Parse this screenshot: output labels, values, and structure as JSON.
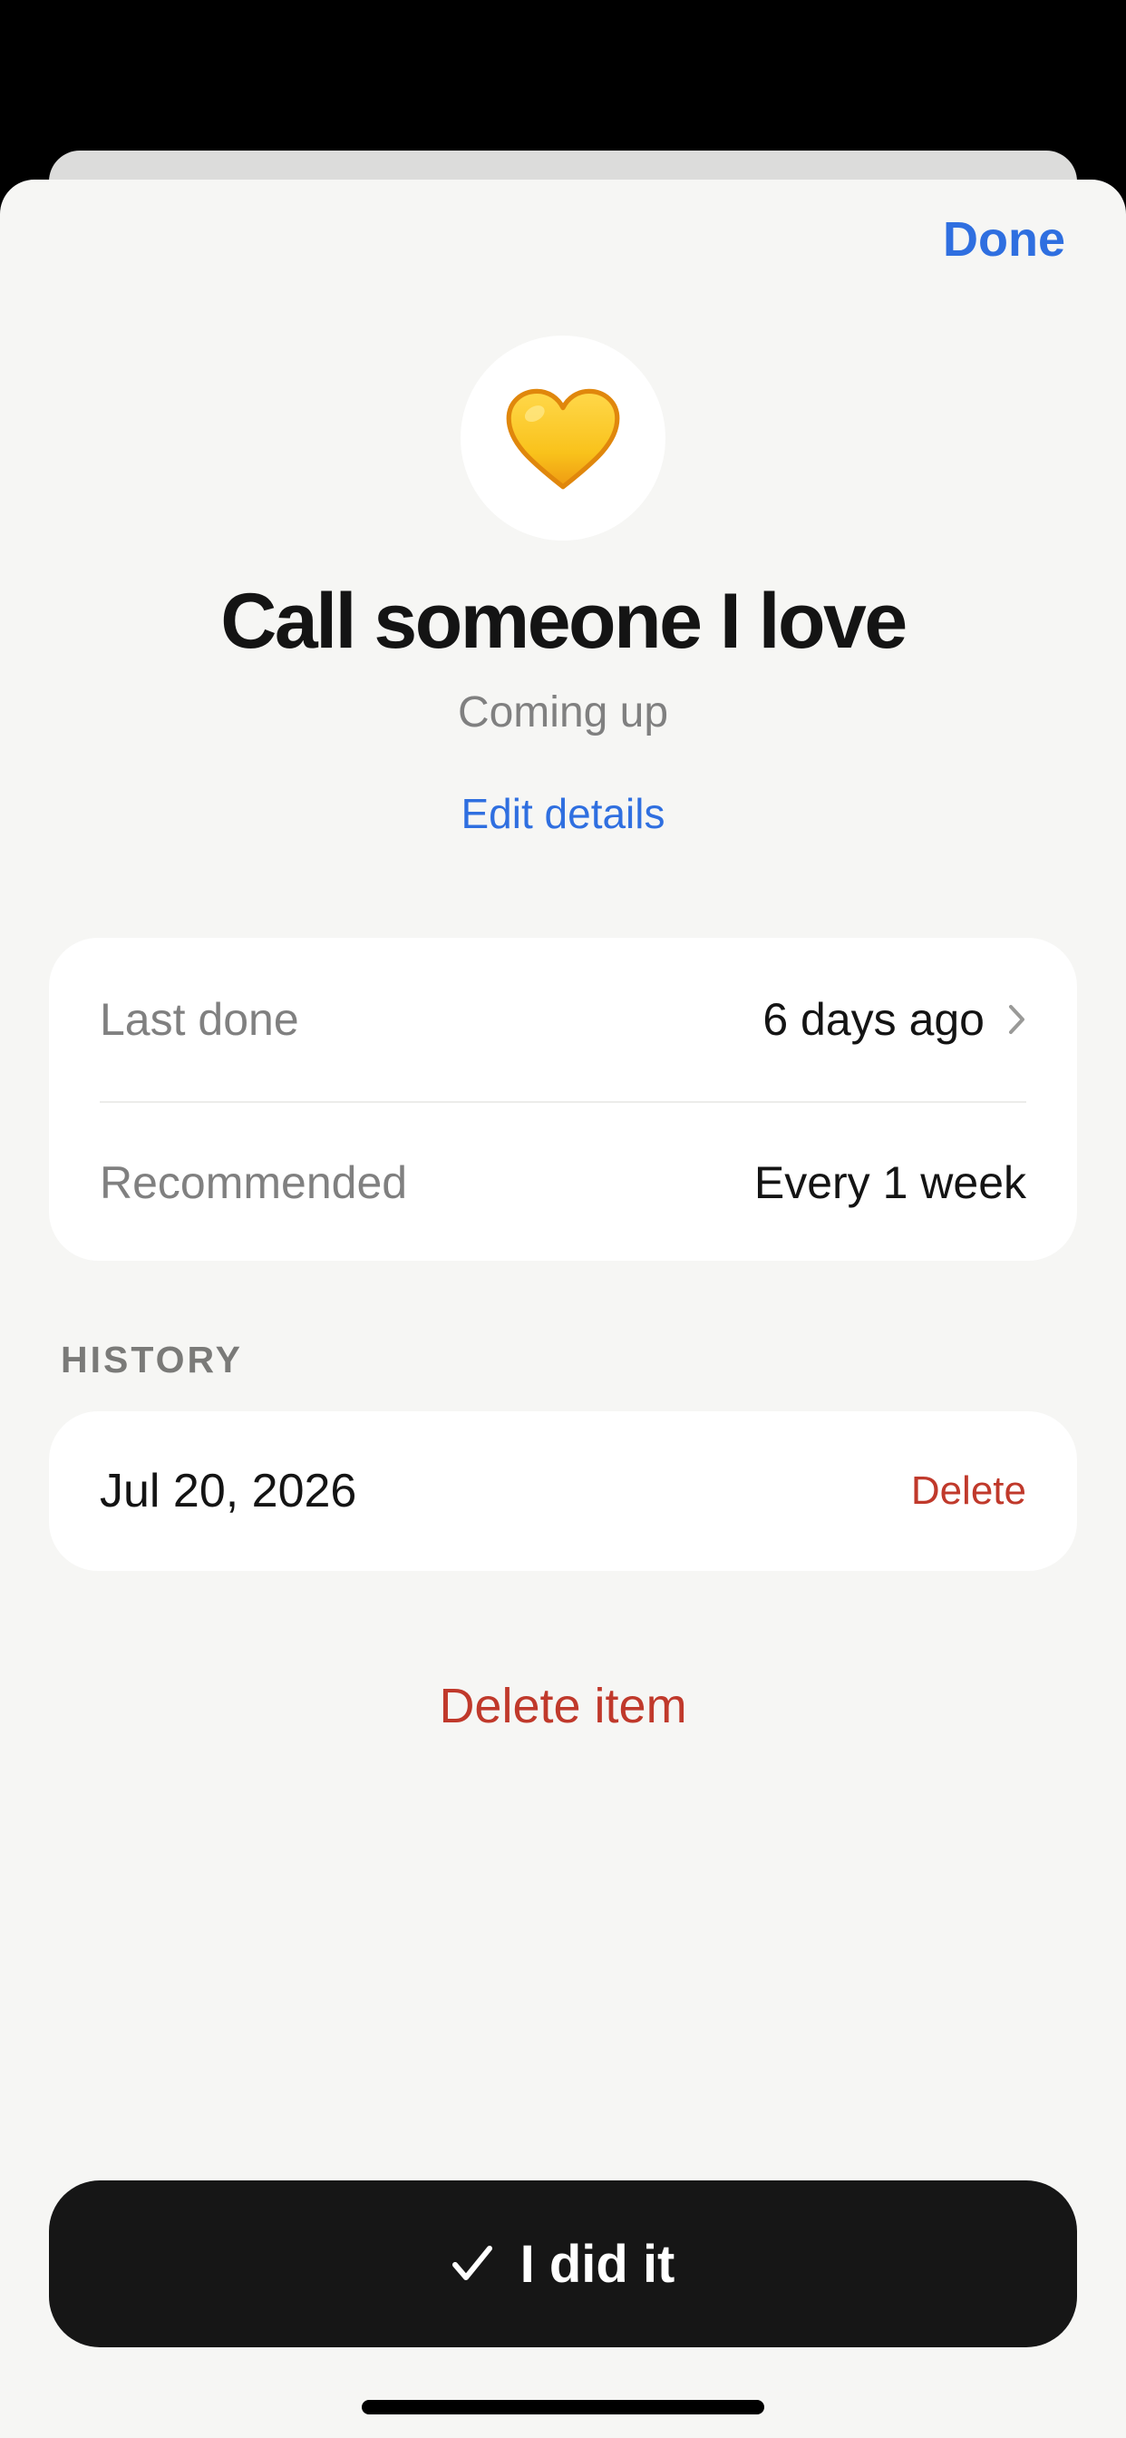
{
  "header": {
    "done_label": "Done"
  },
  "item": {
    "emoji_icon": "yellow-heart-icon",
    "title": "Call someone I love",
    "status": "Coming up",
    "edit_label": "Edit details"
  },
  "details": {
    "last_done_label": "Last done",
    "last_done_value": "6 days ago",
    "recommended_label": "Recommended",
    "recommended_value": "Every 1 week"
  },
  "history": {
    "header": "HISTORY",
    "entries": [
      {
        "date": "Jul 20, 2026",
        "delete_label": "Delete"
      }
    ]
  },
  "actions": {
    "delete_item_label": "Delete item",
    "did_it_label": "I did it"
  },
  "colors": {
    "accent": "#2f6fe0",
    "destructive": "#c0392b",
    "sheet_background": "#f6f6f4",
    "primary_button": "#161616"
  }
}
